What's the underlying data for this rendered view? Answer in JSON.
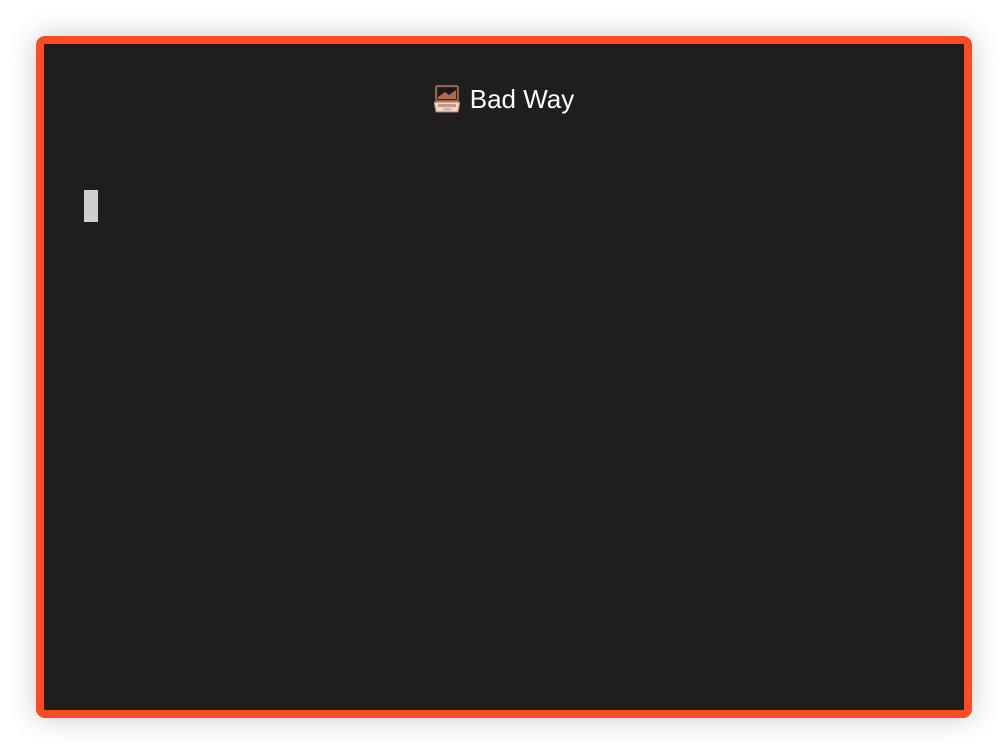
{
  "window": {
    "title": "Bad Way",
    "title_icon": "laptop-icon",
    "border_color": "#ff4b23",
    "background_color": "#1e1e1e"
  },
  "terminal": {
    "content": "",
    "cursor": "block-cursor"
  }
}
